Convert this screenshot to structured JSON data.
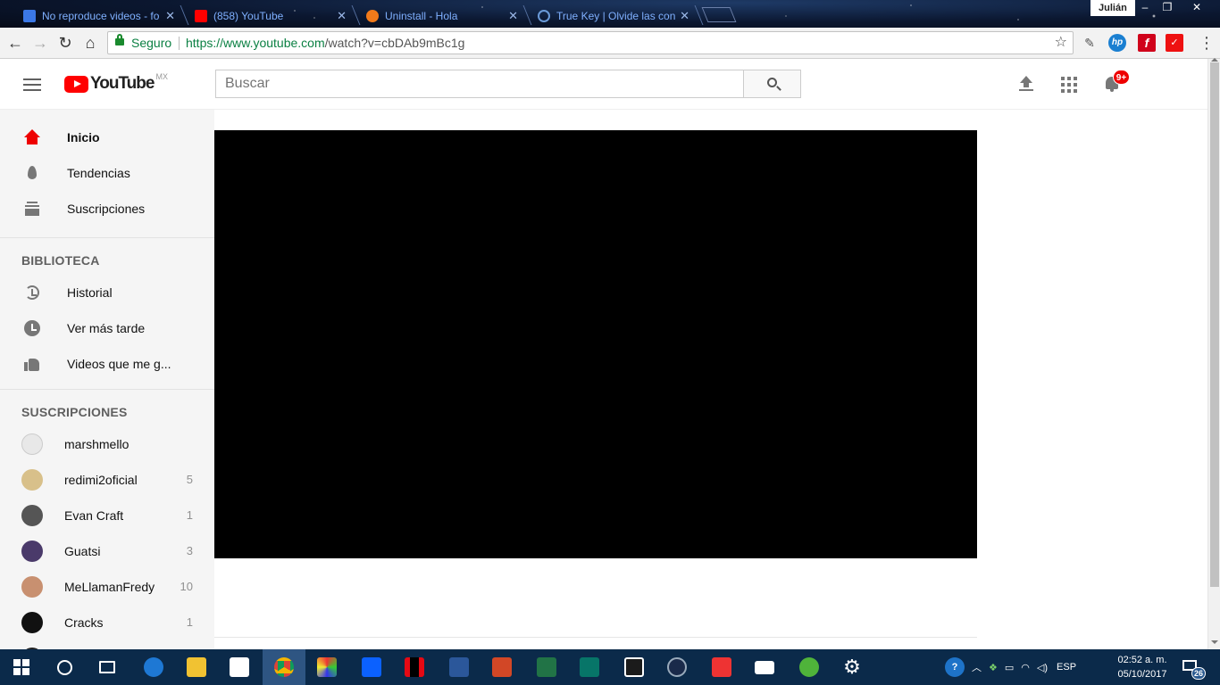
{
  "browser": {
    "tabs": [
      {
        "title": "No reproduce videos - fo",
        "favicon": "doc-icon"
      },
      {
        "title": "(858) YouTube",
        "favicon": "youtube-icon"
      },
      {
        "title": "Uninstall - Hola",
        "favicon": "hola-icon"
      },
      {
        "title": "True Key | Olvide las con",
        "favicon": "truekey-icon"
      }
    ],
    "tab_close": "✕",
    "profile_name": "Julián",
    "window_controls": {
      "minimize": "–",
      "restore": "❐",
      "close": "✕"
    },
    "security_label": "Seguro",
    "url_host": "https://www.youtube.com",
    "url_path": "/watch?v=cbDAb9mBc1g",
    "star": "☆",
    "back": "←",
    "forward": "→",
    "reload": "↻",
    "home": "⌂",
    "menu": "⋮"
  },
  "youtube": {
    "logo_text": "YouTube",
    "logo_country": "MX",
    "search_placeholder": "Buscar",
    "notifications_badge": "9+",
    "nav": [
      {
        "label": "Inicio",
        "icon": "home-icon",
        "active": true
      },
      {
        "label": "Tendencias",
        "icon": "fire-icon"
      },
      {
        "label": "Suscripciones",
        "icon": "subscriptions-icon"
      }
    ],
    "library_heading": "BIBLIOTECA",
    "library": [
      {
        "label": "Historial",
        "icon": "history-icon"
      },
      {
        "label": "Ver más tarde",
        "icon": "clock-icon"
      },
      {
        "label": "Videos que me g...",
        "icon": "like-icon"
      }
    ],
    "subscriptions_heading": "SUSCRIPCIONES",
    "subscriptions": [
      {
        "name": "marshmello",
        "count": "",
        "color": "#e8e8e8"
      },
      {
        "name": "redimi2oficial",
        "count": "5",
        "color": "#d8c08a"
      },
      {
        "name": "Evan Craft",
        "count": "1",
        "color": "#555555"
      },
      {
        "name": "Guatsi",
        "count": "3",
        "color": "#4a3a6a"
      },
      {
        "name": "MeLlamanFredy",
        "count": "10",
        "color": "#c89070"
      },
      {
        "name": "Cracks",
        "count": "1",
        "color": "#111111"
      }
    ]
  },
  "taskbar": {
    "language": "ESP",
    "time": "02:52 a. m.",
    "date": "05/10/2017",
    "notifications_count": "26",
    "pinned": [
      "start",
      "cortana",
      "task-view",
      "edge",
      "file-explorer",
      "store",
      "chrome",
      "app",
      "dropbox",
      "netflix",
      "word",
      "powerpoint",
      "excel",
      "publisher",
      "movies",
      "cinema4d",
      "3d-builder",
      "mail",
      "utorrent",
      "settings"
    ]
  }
}
